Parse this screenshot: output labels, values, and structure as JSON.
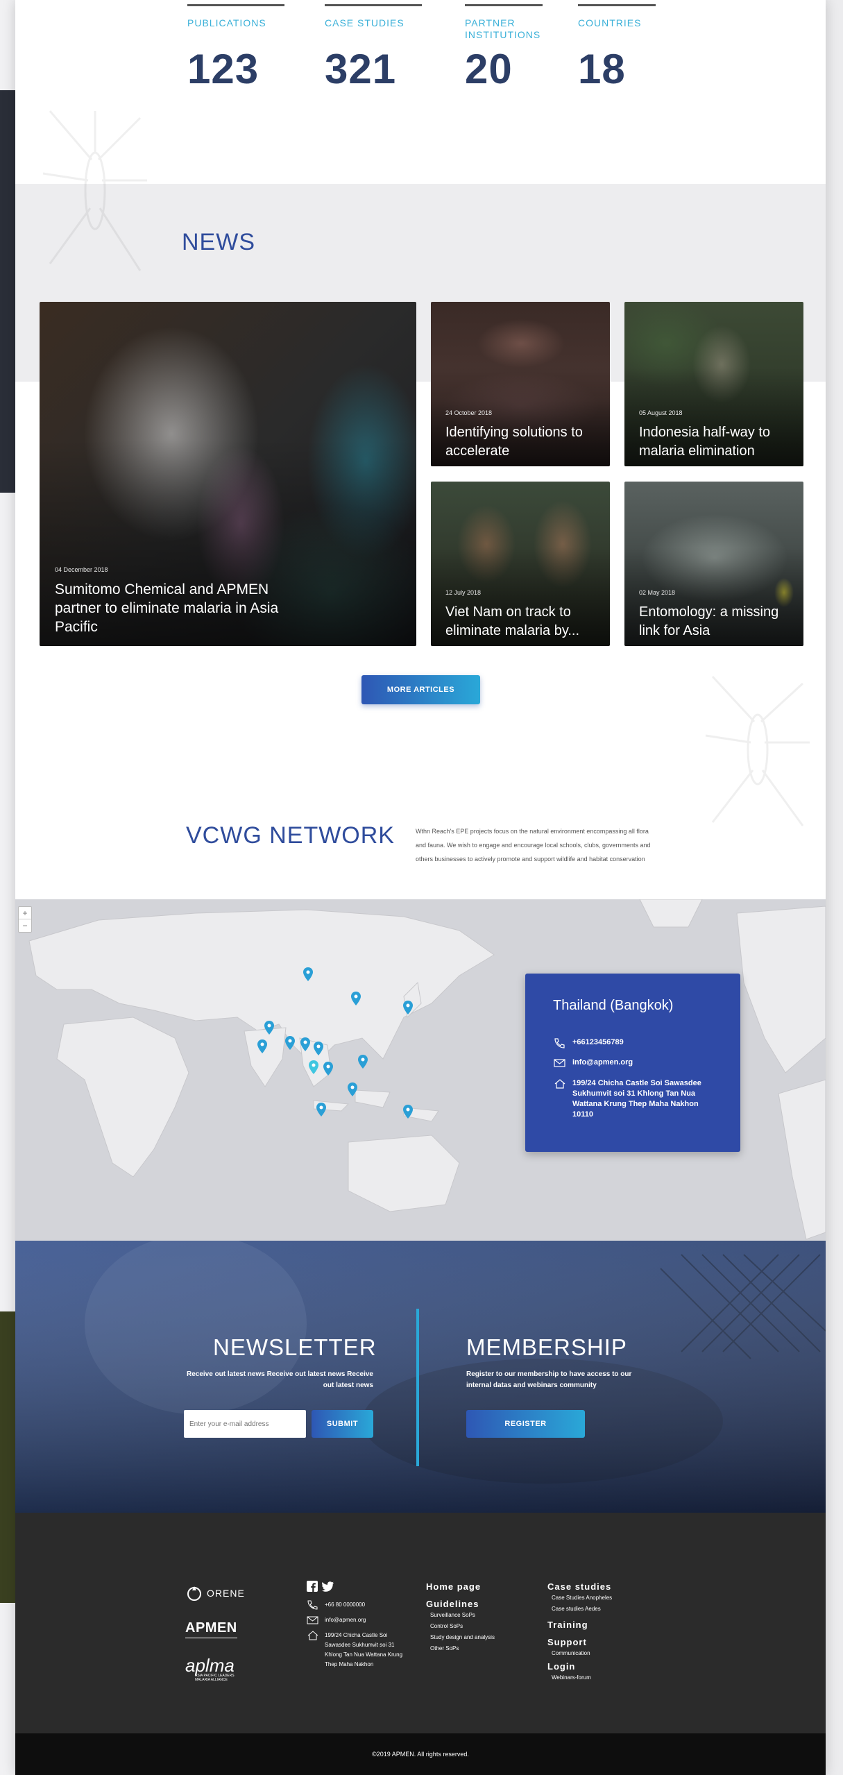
{
  "stats": [
    {
      "label": "PUBLICATIONS",
      "value": "123"
    },
    {
      "label": "CASE STUDIES",
      "value": "321"
    },
    {
      "label": "PARTNER INSTITUTIONS",
      "value": "20"
    },
    {
      "label": "COUNTRIES",
      "value": "18"
    }
  ],
  "news": {
    "title": "NEWS",
    "featured": {
      "date": "04 December 2018",
      "title": "Sumitomo Chemical and APMEN partner to eliminate malaria in Asia Pacific"
    },
    "cards": [
      {
        "date": "24 October 2018",
        "title": "Identifying solutions to accelerate"
      },
      {
        "date": "05 August 2018",
        "title": "Indonesia half-way to malaria elimination"
      },
      {
        "date": "12 July 2018",
        "title": "Viet Nam on track to eliminate malaria by..."
      },
      {
        "date": "02 May 2018",
        "title": "Entomology: a missing link for Asia"
      }
    ],
    "more_label": "MORE ARTICLES"
  },
  "network": {
    "title": "VCWG NETWORK",
    "description": "Wthn Reach's EPE projects focus on the natural environment encompassing all flora and fauna. We wish to engage and encourage local schools, clubs, governments and others businesses to actively promote and support wildlife and habitat conservation"
  },
  "map": {
    "zoom_in": "+",
    "zoom_out": "−",
    "info": {
      "title": "Thailand (Bangkok)",
      "phone": "+66123456789",
      "email": "info@apmen.org",
      "address": "199/24 Chicha Castle Soi Sawasdee Sukhumvit soi 31 Khlong Tan Nua Wattana Krung Thep Maha Nakhon 10110"
    },
    "pin_color": "#2a9fd6"
  },
  "newsletter": {
    "title": "NEWSLETTER",
    "subtitle": "Receive out latest news Receive out latest news Receive out latest news",
    "placeholder": "Enter your e-mail address",
    "submit": "SUBMIT"
  },
  "membership": {
    "title": "MEMBERSHIP",
    "subtitle": "Register to our membership to have access to our internal datas and webinars community",
    "register": "REGISTER"
  },
  "footer": {
    "logos": {
      "orene": "ORENE",
      "apmen": "APMEN",
      "aplma": "aplma",
      "aplma_sub": "ASIA PACIFIC LEADERS MALARIA ALLIANCE"
    },
    "phone": "+66 80 0000000",
    "email": "info@apmen.org",
    "address": "199/24 Chicha Castle Soi Sawasdee Sukhumvit soi 31 Khlong Tan Nua Wattana Krung Thep Maha Nakhon",
    "col3": [
      {
        "label": "Home page",
        "subs": []
      },
      {
        "label": "Guidelines",
        "subs": [
          "Surveillance SoPs",
          "Control SoPs",
          "Study design and analysis",
          "Other SoPs"
        ]
      }
    ],
    "col4": [
      {
        "label": "Case studies",
        "subs": [
          "Case Studies Anopheles",
          "Case studies Aedes"
        ]
      },
      {
        "label": "Training",
        "subs": []
      },
      {
        "label": "Support",
        "subs": [
          "Communication"
        ]
      },
      {
        "label": "Login",
        "subs": [
          "Webinars-forum"
        ]
      }
    ],
    "copyright": "©2019 APMEN. All rights reserved."
  },
  "colors": {
    "accent_blue": "#2f4c9c",
    "cyan": "#2aa8d8",
    "info_box": "#2f4aa6",
    "footer_bg": "#2b2b2b"
  }
}
